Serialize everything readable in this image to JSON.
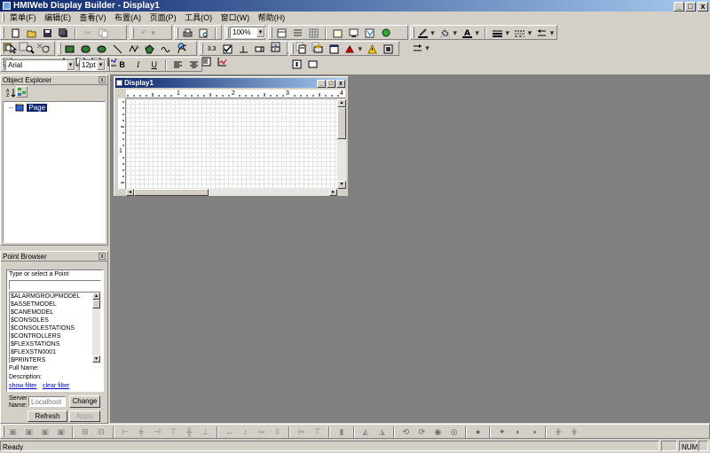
{
  "window": {
    "title": "HMIWeb Display Builder - Display1",
    "min_label": "_",
    "max_label": "□",
    "close_label": "x"
  },
  "menubar": {
    "items": [
      "菜单(F)",
      "编辑(E)",
      "查看(V)",
      "布置(A)",
      "页面(P)",
      "工具(O)",
      "窗口(W)",
      "帮助(H)"
    ]
  },
  "toolbar": {
    "zoom_value": "100%",
    "font_name": "Arial",
    "font_size": "12pt",
    "bold_label": "B",
    "italic_label": "I",
    "underline_label": "U",
    "snap_value": "3.3"
  },
  "object_explorer": {
    "title": "Object Explorer",
    "close_label": "x",
    "tree_root": "Page"
  },
  "point_browser": {
    "title": "Point Browser",
    "close_label": "x",
    "search_label": "Type or select a Point",
    "search_value": "",
    "points": [
      "$ALARMGROUPMODEL",
      "$ASSETMODEL",
      "$CANEMODEL",
      "$CONSOLES",
      "$CONSOLESTATIONS",
      "$CONTROLLERS",
      "$FLEXSTATIONS",
      "$FLEXSTN0001",
      "$PRINTERS"
    ],
    "full_name_label": "Full Name:",
    "description_label": "Description:",
    "show_filter": "show filter",
    "clear_filter": "clear filter",
    "server_label_1": "Server",
    "server_label_2": "Name:",
    "server_placeholder": "Localhost",
    "change_button": "Change",
    "refresh_button": "Refresh",
    "apply_button": "Apply"
  },
  "display_window": {
    "title": "Display1",
    "ruler_marks": [
      "1",
      "2",
      "3",
      "4"
    ],
    "vruler_mark": "1"
  },
  "statusbar": {
    "status_text": "Ready",
    "num_indicator": "NUM"
  },
  "colors": {
    "title_active": "#0a246a",
    "title_gradient_end": "#a6caf0",
    "face": "#d4d0c8",
    "mdi_background": "#808080",
    "selection": "#0a246a"
  }
}
